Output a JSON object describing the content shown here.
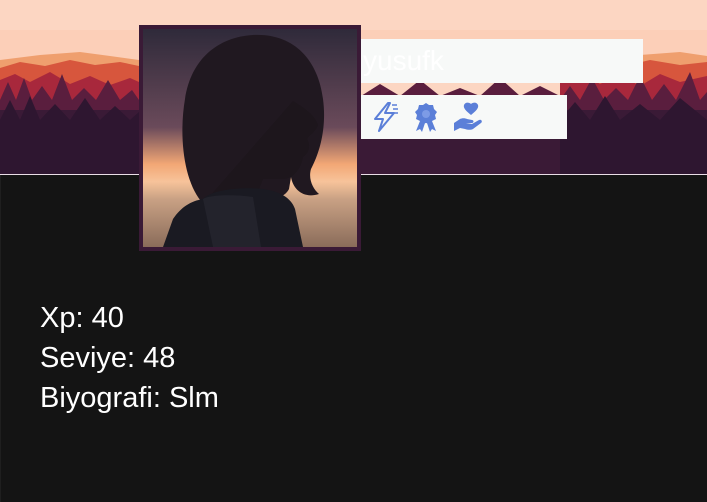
{
  "profile": {
    "username": "yusufk",
    "badges": [
      {
        "icon": "lightning-bolt-icon",
        "color": "#5b7fd8"
      },
      {
        "icon": "award-ribbon-icon",
        "color": "#5b7fd8"
      },
      {
        "icon": "hand-holding-heart-icon",
        "color": "#5b7fd8"
      }
    ],
    "stats": {
      "xp": "Xp: 40",
      "level": "Seviye: 48",
      "bio": "Biyografi: Slm"
    }
  },
  "colors": {
    "banner_sky": "#fbd4c0",
    "mountain_far": "#e98a5a",
    "mountain_mid": "#c9463a",
    "forest": "#3a1a36",
    "content_bg": "#141414",
    "avatar_border": "#3a1a36",
    "badge_color": "#5b7fd8"
  }
}
